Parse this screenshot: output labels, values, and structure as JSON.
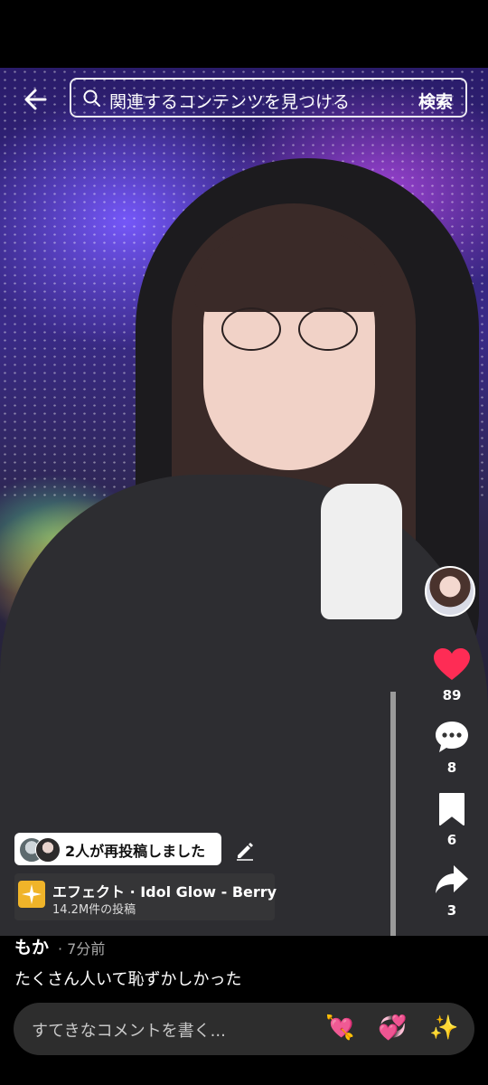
{
  "header": {
    "search_placeholder": "関連するコンテンツを見つける",
    "search_button": "検索"
  },
  "actions": {
    "likes": "89",
    "comments": "8",
    "saves": "6",
    "shares": "3"
  },
  "repost_banner": {
    "text": "2人が再投稿しました"
  },
  "effect": {
    "name": "エフェクト · Idol Glow - Berry",
    "count": "14.2M件の投稿"
  },
  "post": {
    "author": "もか",
    "time": "· 7分前",
    "caption": "たくさん人いて恥ずかしかった"
  },
  "comment_bar": {
    "placeholder": "すてきなコメントを書く..."
  },
  "colors": {
    "like": "#fe2c55",
    "effect_icon": "#f0b429"
  }
}
